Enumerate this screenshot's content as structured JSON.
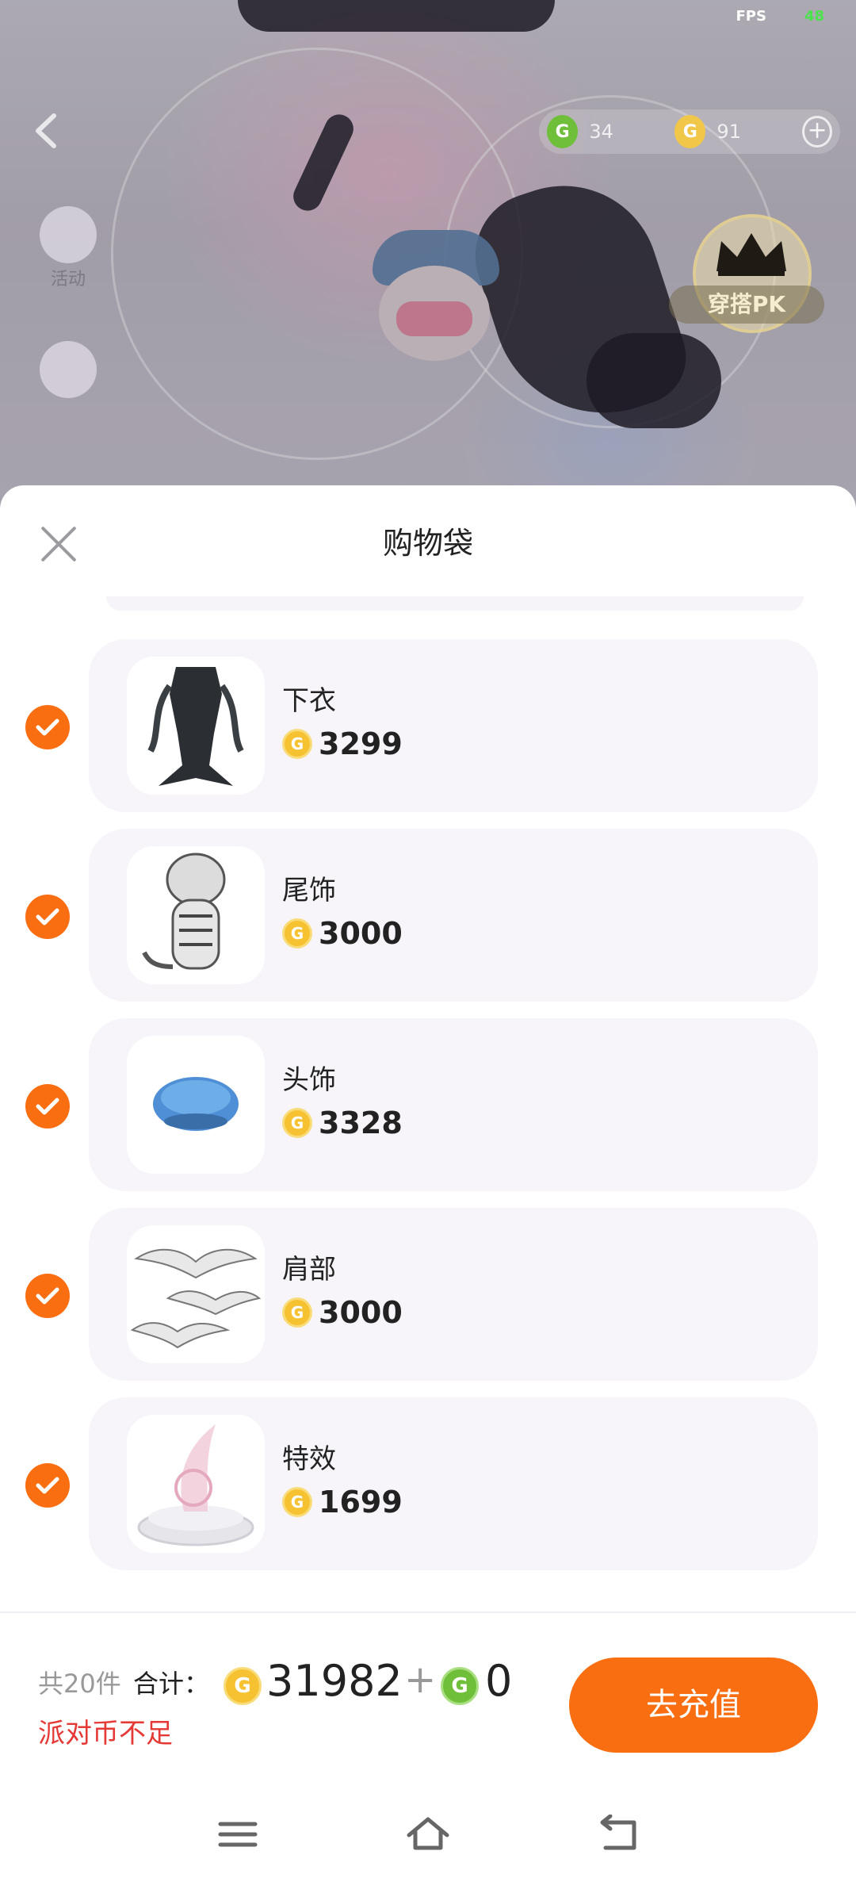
{
  "status": {
    "fps_label": "FPS",
    "fps_value": "48"
  },
  "game": {
    "side_menu": [
      {
        "label": "活动"
      }
    ],
    "currencies": [
      {
        "icon": "g-coin-green",
        "value": "34"
      },
      {
        "icon": "g-coin-gold",
        "value": "91"
      }
    ],
    "pk_label": "穿搭PK"
  },
  "sheet": {
    "title": "购物袋",
    "items": [
      {
        "name": "下衣",
        "price": "3299",
        "checked": true,
        "icon": "mermaid-tail-skirt"
      },
      {
        "name": "尾饰",
        "price": "3000",
        "checked": true,
        "icon": "white-tiger"
      },
      {
        "name": "头饰",
        "price": "3328",
        "checked": true,
        "icon": "blue-beret"
      },
      {
        "name": "肩部",
        "price": "3000",
        "checked": true,
        "icon": "white-eagles"
      },
      {
        "name": "特效",
        "price": "1699",
        "checked": true,
        "icon": "crystal-pedestal"
      }
    ]
  },
  "footer": {
    "count_label": "共20件",
    "total_label": "合计：",
    "gold_total": "31982",
    "plus": "+",
    "green_total": "0",
    "warning": "派对币不足",
    "recharge_label": "去充值"
  },
  "colors": {
    "accent": "#fa6e12",
    "gold": "#f6c232",
    "green": "#6fbf3a",
    "warning": "#e53935"
  }
}
